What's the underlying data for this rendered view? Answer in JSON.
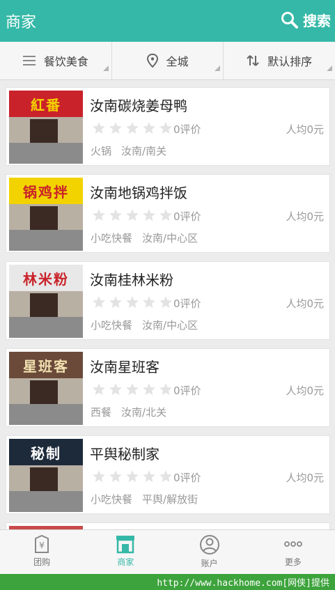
{
  "header": {
    "title": "商家",
    "search_label": "搜索",
    "color": "#35b8a7"
  },
  "filters": [
    {
      "label": "餐饮美食",
      "icon": "menu-icon"
    },
    {
      "label": "全城",
      "icon": "location-pin-icon"
    },
    {
      "label": "默认排序",
      "icon": "sort-icon"
    }
  ],
  "merchants": [
    {
      "name": "汝南碳烧姜母鸭",
      "rating": 0,
      "reviews": "0评价",
      "avg_price": "人均0元",
      "category": "火锅",
      "area": "汝南/南关",
      "sign_text": "紅番",
      "sign_color": "#c9222a",
      "sign_text_color": "#f5d200"
    },
    {
      "name": "汝南地锅鸡拌饭",
      "rating": 0,
      "reviews": "0评价",
      "avg_price": "人均0元",
      "category": "小吃快餐",
      "area": "汝南/中心区",
      "sign_text": "锅鸡拌",
      "sign_color": "#f2d300",
      "sign_text_color": "#c9222a"
    },
    {
      "name": "汝南桂林米粉",
      "rating": 0,
      "reviews": "0评价",
      "avg_price": "人均0元",
      "category": "小吃快餐",
      "area": "汝南/中心区",
      "sign_text": "林米粉",
      "sign_color": "#e8e8e8",
      "sign_text_color": "#c9222a"
    },
    {
      "name": "汝南星班客",
      "rating": 0,
      "reviews": "0评价",
      "avg_price": "人均0元",
      "category": "西餐",
      "area": "汝南/北关",
      "sign_text": "星班客",
      "sign_color": "#6b4a3a",
      "sign_text_color": "#f0e0b0"
    },
    {
      "name": "平舆秘制家",
      "rating": 0,
      "reviews": "0评价",
      "avg_price": "人均0元",
      "category": "小吃快餐",
      "area": "平舆/解放街",
      "sign_text": "秘制",
      "sign_color": "#1d2a3a",
      "sign_text_color": "#ffffff"
    }
  ],
  "tabs": [
    {
      "label": "团购",
      "icon": "groupon-icon",
      "active": false
    },
    {
      "label": "商家",
      "icon": "store-icon",
      "active": true
    },
    {
      "label": "账户",
      "icon": "account-icon",
      "active": false
    },
    {
      "label": "更多",
      "icon": "more-icon",
      "active": false
    }
  ],
  "footer": {
    "url_text": "http://www.hackhome.com[网侠]提供"
  }
}
